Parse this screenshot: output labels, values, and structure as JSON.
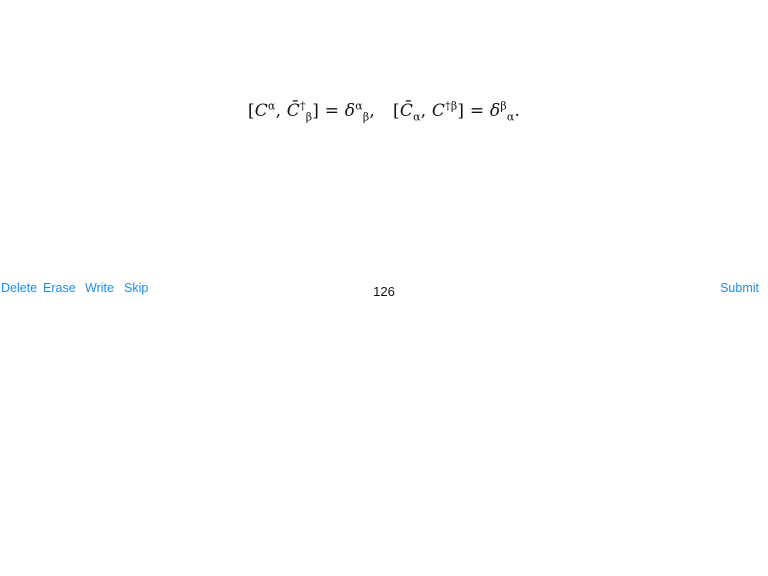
{
  "formula": {
    "part1": {
      "open": "[",
      "c": "C",
      "c_sup": "α",
      "comma": ", ",
      "cbar": "C̄",
      "cbar_sup": "†",
      "cbar_sub": "β",
      "close_eq": "] = ",
      "delta": "δ",
      "delta_sup": "α",
      "delta_sub": "β",
      "end": ","
    },
    "part2": {
      "open": "[",
      "cbar": "C̄",
      "cbar_sub": "α",
      "comma": ", ",
      "c": "C",
      "c_sup": "†β",
      "close_eq": "] = ",
      "delta": "δ",
      "delta_sup": "β",
      "delta_sub": "α",
      "end": "."
    }
  },
  "toolbar": {
    "delete_label": "Delete",
    "erase_label": "Erase",
    "write_label": "Write",
    "skip_label": "Skip",
    "submit_label": "Submit"
  },
  "page": {
    "number": "126"
  },
  "colors": {
    "accent": "#1f8bf0",
    "text": "#111111",
    "background": "#ffffff"
  }
}
